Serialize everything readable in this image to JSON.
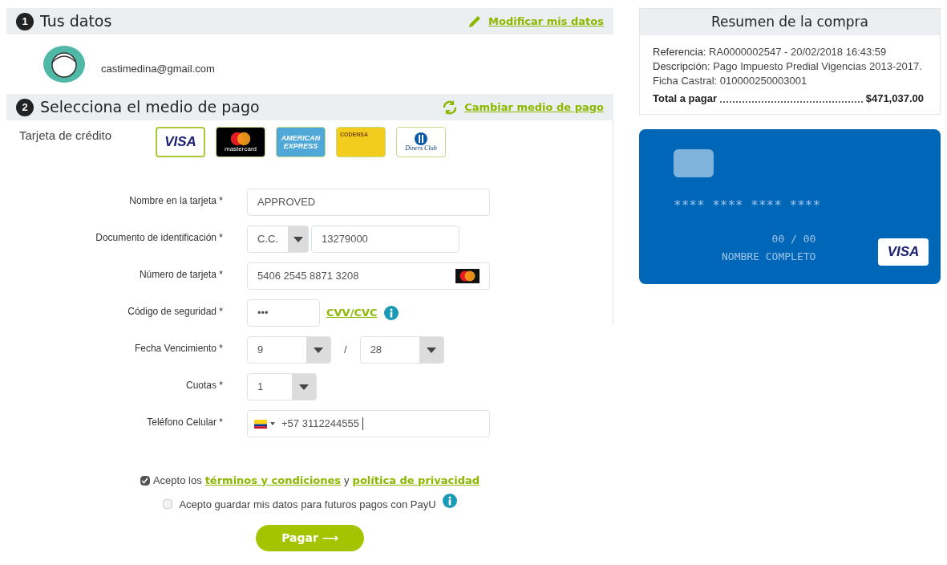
{
  "user_section": {
    "number": "1",
    "title": "Tus datos",
    "action": "Modificar mis datos",
    "email": "castimedina@gmail.com"
  },
  "payment_section": {
    "number": "2",
    "title": "Selecciona el medio de pago",
    "action": "Cambiar medio de pago",
    "method_label": "Tarjeta de crédito",
    "cards": [
      {
        "kind": "visa",
        "label": "VISA",
        "selected": true
      },
      {
        "kind": "mastercard",
        "label": "mastercard",
        "selected": false
      },
      {
        "kind": "amex",
        "label": "AMERICAN EXPRESS",
        "selected": false
      },
      {
        "kind": "codensa",
        "label": "CODENSA",
        "selected": false
      },
      {
        "kind": "diners",
        "label": "Diners Club",
        "selected": false
      }
    ]
  },
  "form": [
    {
      "kind": "text",
      "label": "Nombre en la tarjeta *",
      "value": "APPROVED"
    },
    {
      "kind": "document",
      "label": "Documento de identificación *",
      "type": "C.C.",
      "value": "13279000"
    },
    {
      "kind": "card",
      "label": "Número de tarjeta *",
      "value": "5406 2545 8871 3208"
    },
    {
      "kind": "cvv",
      "label": "Código de seguridad *",
      "value": "•••",
      "link": "CVV/CVC"
    },
    {
      "kind": "expiry",
      "label": "Fecha Vencimiento *",
      "month": "9",
      "separator": "/",
      "year": "28"
    },
    {
      "kind": "select",
      "label": "Cuotas *",
      "value": "1"
    },
    {
      "kind": "phone",
      "label": "Teléfono Celular *",
      "value": "+57 3112244555"
    }
  ],
  "consents": [
    {
      "kind": "terms",
      "checked": true,
      "text": "Acepto los",
      "link1": "términos y condiciones",
      "joiner": "y",
      "link2": "política de privacidad"
    },
    {
      "kind": "save",
      "checked": false,
      "text": "Acepto guardar mis datos para futuros pagos con PayU"
    }
  ],
  "submit": "Pagar ⟶",
  "summary": {
    "title": "Resumen de la compra",
    "reference_label": "Referencia:",
    "reference": "RA0000002547 - 20/02/2018 16:43:59",
    "description_label": "Descripción:",
    "description": "Pago Impuesto Predial Vigencias 2013-2017. Ficha Castral: 010000250003001",
    "total_label": "Total a pagar",
    "total": "$471,037.00"
  },
  "card_preview": {
    "number": "**** **** **** ****",
    "expiry": "00 / 00",
    "name": "NOMBRE COMPLETO",
    "brand": "VISA"
  }
}
